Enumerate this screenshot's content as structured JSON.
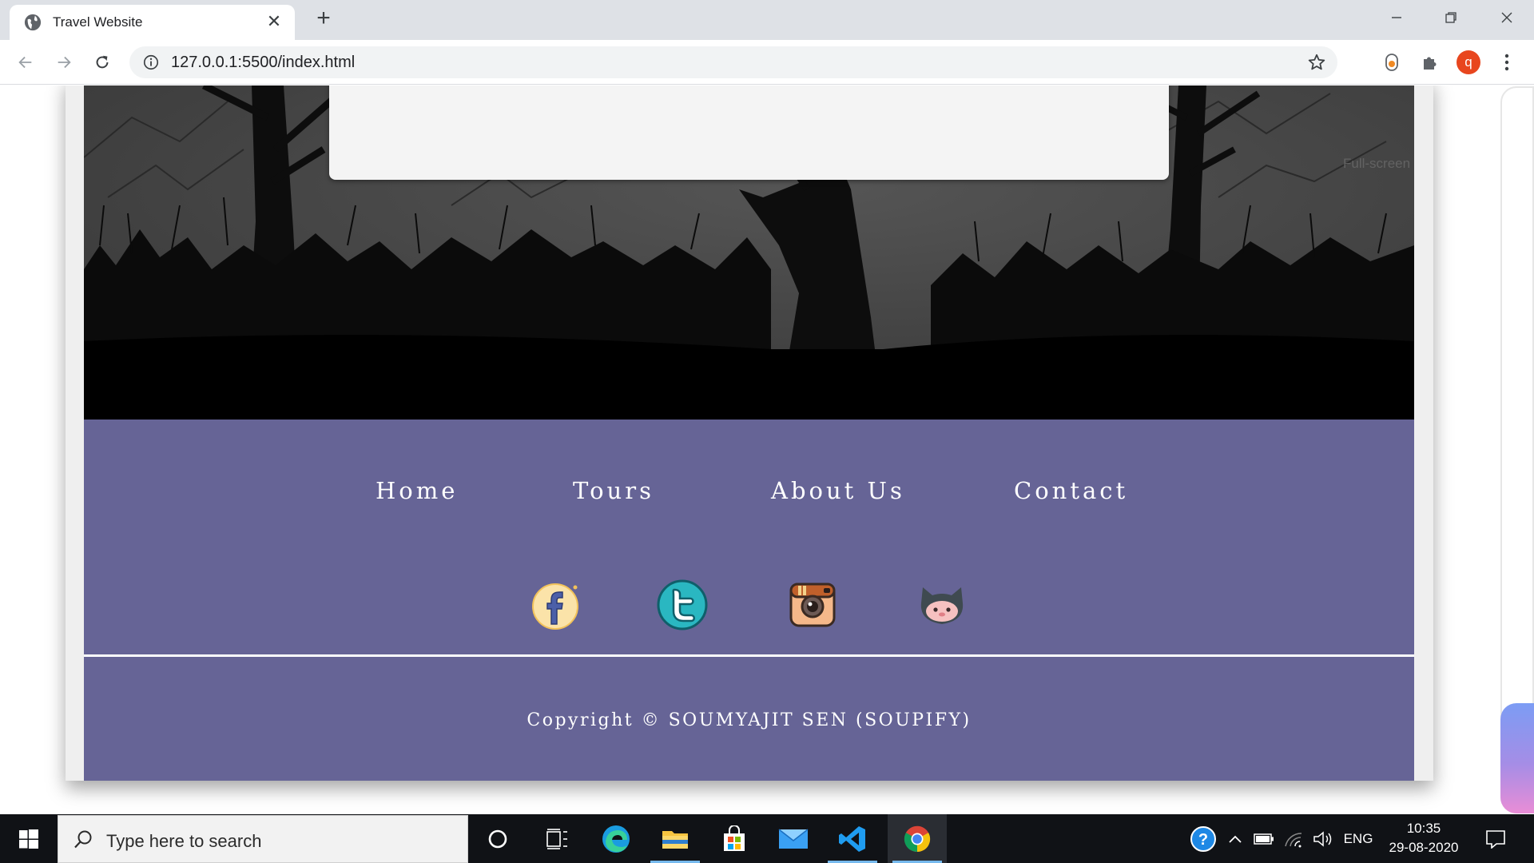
{
  "browser": {
    "tab_title": "Travel Website",
    "url": "127.0.0.1:5500/index.html",
    "profile_initial": "q"
  },
  "page": {
    "fullscreen_hint": "Full-screen",
    "footer_nav": [
      "Home",
      "Tours",
      "About Us",
      "Contact"
    ],
    "social": [
      "facebook",
      "twitter",
      "instagram",
      "github"
    ],
    "copyright": "Copyright © SOUMYAJIT SEN (SOUPIFY)",
    "footer_color": "#666496"
  },
  "taskbar": {
    "search_placeholder": "Type here to search",
    "language": "ENG",
    "time": "10:35",
    "date": "29-08-2020"
  }
}
